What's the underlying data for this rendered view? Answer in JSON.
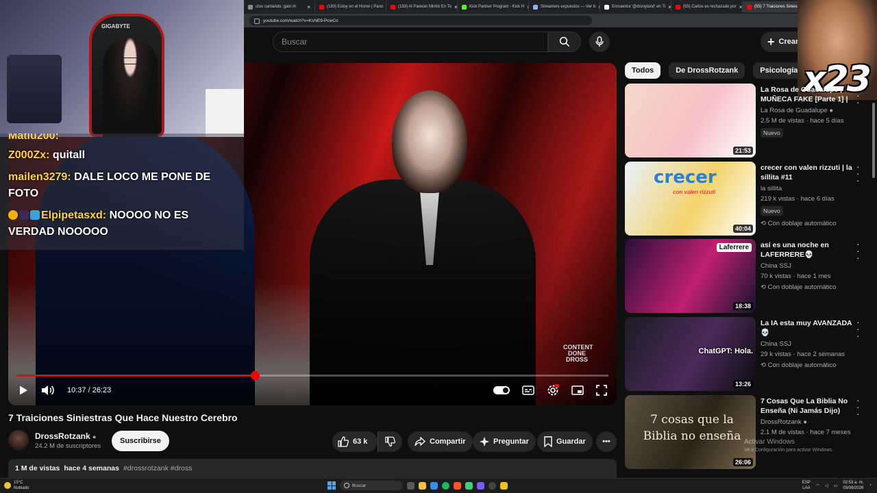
{
  "browser": {
    "tabs": [
      {
        "label": "ctos cantando: gato m",
        "color": "#888888"
      },
      {
        "label": "(193) Estoy en el Horno | Pano",
        "color": "#ff0000"
      },
      {
        "label": "(193) Al Parecer Mintió En To",
        "color": "#ff0000"
      },
      {
        "label": "Kick Partner Program - Kick H",
        "color": "#53fc18"
      },
      {
        "label": "Streamers expuestos — Ver b",
        "color": "#8ab4f8"
      },
      {
        "label": "Encuentra '@dsroyland' en Ti",
        "color": "#ffffff"
      },
      {
        "label": "(55) Carlos es rechazado por",
        "color": "#ff0000"
      },
      {
        "label": "(55) 7 Traiciones Siniestra",
        "color": "#ff0000",
        "active": true
      }
    ],
    "url": "youtube.com/watch?v=KsNE9-PcwCo"
  },
  "header": {
    "search_placeholder": "Buscar",
    "create_label": "Crear"
  },
  "stream_overlay": {
    "chair_brand": "GIGABYTE",
    "meme_counter": "x23",
    "chat": [
      {
        "user": "Matiu200:",
        "text": "",
        "cut": true
      },
      {
        "user": "Z000Zx:",
        "text": "quitall"
      },
      {
        "user": "mailen3279:",
        "text": "DALE LOCO ME PONE DE FOTO"
      },
      {
        "user": "Elpipetasxd:",
        "text": "NOOOO NO ES VERDAD NOOOOO",
        "emotes": true
      }
    ]
  },
  "player": {
    "time_current": "10:37",
    "time_total": "26:23",
    "time_display": "10:37 / 26:23",
    "progress": 0.403,
    "watermark": "CONTENT DONE DROSS"
  },
  "video": {
    "title": "7 Traiciones Siniestras Que Hace Nuestro Cerebro",
    "channel": "DrossRotzank",
    "subscribers": "24.2 M de suscriptores",
    "subscribe_label": "Suscribirse",
    "likes": "63 k",
    "share_label": "Compartir",
    "ask_label": "Preguntar",
    "save_label": "Guardar",
    "views": "1 M de vistas",
    "age": "hace 4 semanas",
    "tags": "#drossrotzank #dross"
  },
  "chips": [
    "Todos",
    "De DrossRotzank",
    "Psicología",
    "Pe"
  ],
  "recommendations": [
    {
      "title": "La Rosa de Guadalupe | MUÑECA FAKE [Parte 1] | ...",
      "channel": "La Rosa de Guadalupe",
      "verified": true,
      "meta": "2.5 M de vistas · hace 5 días",
      "badge": "Nuevo",
      "dubbed": "",
      "duration": "21:53",
      "thumb_text": "",
      "colors": [
        "#f4d8c8",
        "#f6c1c7",
        "#ffffff"
      ]
    },
    {
      "title": "crecer con valen rizzuti | la sillita #11",
      "channel": "la sillita",
      "verified": false,
      "meta": "219 k vistas · hace 6 días",
      "badge": "Nuevo",
      "dubbed": "Con doblaje automático",
      "duration": "40:04",
      "thumb_text": "crecer",
      "thumb_subtext": "con valen rizzuti",
      "colors": [
        "#e8f2fb",
        "#f3d36a",
        "#ffffff"
      ]
    },
    {
      "title": "así es una noche en LAFERRERE💀",
      "channel": "China SSJ",
      "verified": false,
      "meta": "70 k vistas · hace 1 mes",
      "badge": "",
      "dubbed": "Con doblaje automático",
      "duration": "18:38",
      "thumb_text": "Laferrere",
      "colors": [
        "#2a0f3a",
        "#c02070",
        "#141430"
      ]
    },
    {
      "title": "La IA esta muy AVANZADA 💀",
      "channel": "China SSJ",
      "verified": false,
      "meta": "29 k vistas · hace 2 semanas",
      "badge": "",
      "dubbed": "Con doblaje automático",
      "duration": "13:26",
      "thumb_text": "ChatGPT: Hola.",
      "colors": [
        "#1c1c24",
        "#4a2a5a",
        "#0c0c10"
      ]
    },
    {
      "title": "7 Cosas Que La Biblia No Enseña (Ni Jamás Dijo)",
      "channel": "DrossRotzank",
      "verified": true,
      "meta": "2.1 M de vistas · hace 7 meses",
      "badge": "",
      "dubbed": "",
      "duration": "26:06",
      "thumb_text": "7 cosas que la Biblia no enseña",
      "colors": [
        "#5a5040",
        "#2a2418",
        "#7a6a50"
      ]
    }
  ],
  "os": {
    "activate_title": "Activar Windows",
    "activate_sub": "Ve a Configuración para activar Windows.",
    "weather_temp": "15°C",
    "weather_desc": "Nublado",
    "taskbar_search": "Buscar",
    "lang_1": "ESP",
    "lang_2": "LAA",
    "time": "02:53 a. m.",
    "date": "03/08/2026"
  }
}
